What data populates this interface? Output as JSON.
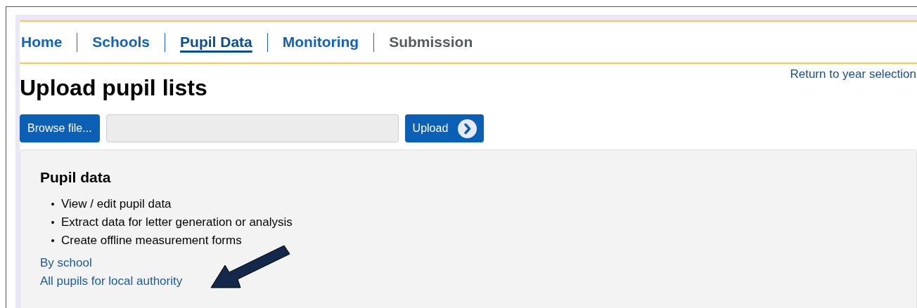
{
  "nav": [
    {
      "label": "Home",
      "selected": false,
      "disabled": false
    },
    {
      "label": "Schools",
      "selected": false,
      "disabled": false
    },
    {
      "label": "Pupil Data",
      "selected": true,
      "disabled": false
    },
    {
      "label": "Monitoring",
      "selected": false,
      "disabled": false
    },
    {
      "label": "Submission",
      "selected": false,
      "disabled": true
    }
  ],
  "return_link": "Return to year selection",
  "title": "Upload pupil lists",
  "upload": {
    "browse_button": "Browse file...",
    "upload_button": "Upload"
  },
  "panel": {
    "heading": "Pupil data",
    "bullets": [
      "View / edit pupil data",
      "Extract data for letter generation or analysis",
      "Create offline measurement forms"
    ],
    "links": [
      "By school",
      "All pupils for local authority"
    ]
  }
}
